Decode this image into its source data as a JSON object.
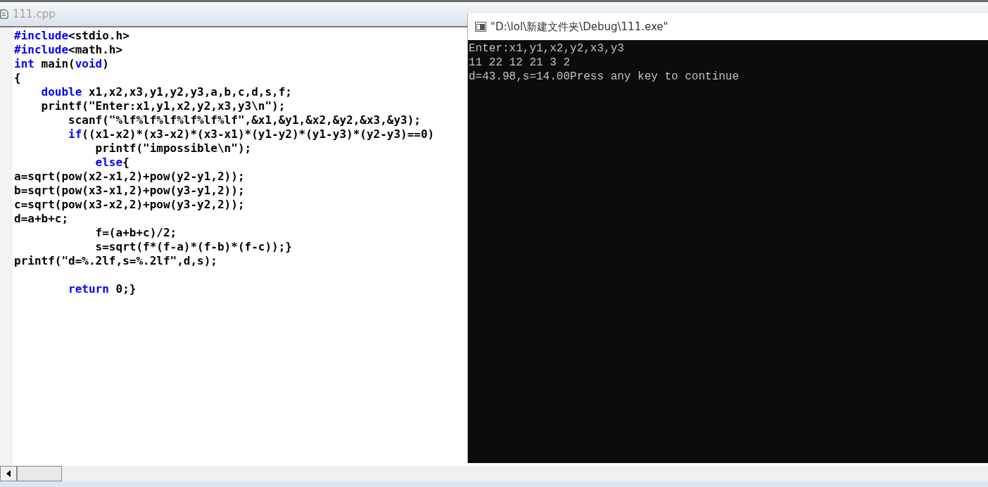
{
  "editor": {
    "tab_title": "111.cpp",
    "lines": [
      {
        "kind": "code",
        "segments": [
          {
            "keyword": true,
            "text": "#include"
          },
          {
            "keyword": false,
            "text": "<stdio.h>"
          }
        ]
      },
      {
        "kind": "code",
        "segments": [
          {
            "keyword": true,
            "text": "#include"
          },
          {
            "keyword": false,
            "text": "<math.h>"
          }
        ]
      },
      {
        "kind": "code",
        "segments": [
          {
            "keyword": true,
            "text": "int"
          },
          {
            "keyword": false,
            "text": " main("
          },
          {
            "keyword": true,
            "text": "void"
          },
          {
            "keyword": false,
            "text": ")"
          }
        ]
      },
      {
        "kind": "code",
        "segments": [
          {
            "keyword": false,
            "text": "{"
          }
        ]
      },
      {
        "kind": "code",
        "segments": [
          {
            "keyword": true,
            "text": "    double"
          },
          {
            "keyword": false,
            "text": " x1,x2,x3,y1,y2,y3,a,b,c,d,s,f;"
          }
        ]
      },
      {
        "kind": "code",
        "segments": [
          {
            "keyword": false,
            "text": "    printf(\"Enter:x1,y1,x2,y2,x3,y3\\n\");"
          }
        ]
      },
      {
        "kind": "code",
        "segments": [
          {
            "keyword": false,
            "text": "        scanf(\"%lf%lf%lf%lf%lf%lf\",&x1,&y1,&x2,&y2,&x3,&y3);"
          }
        ]
      },
      {
        "kind": "code",
        "segments": [
          {
            "keyword": true,
            "text": "        if"
          },
          {
            "keyword": false,
            "text": "((x1-x2)*(x3-x2)*(x3-x1)*(y1-y2)*(y1-y3)*(y2-y3)==0)"
          }
        ]
      },
      {
        "kind": "code",
        "segments": [
          {
            "keyword": false,
            "text": "            printf(\"impossible\\n\");"
          }
        ]
      },
      {
        "kind": "code",
        "segments": [
          {
            "keyword": true,
            "text": "            else"
          },
          {
            "keyword": false,
            "text": "{"
          }
        ]
      },
      {
        "kind": "code",
        "segments": [
          {
            "keyword": false,
            "text": "a=sqrt(pow(x2-x1,2)+pow(y2-y1,2));"
          }
        ]
      },
      {
        "kind": "code",
        "segments": [
          {
            "keyword": false,
            "text": "b=sqrt(pow(x3-x1,2)+pow(y3-y1,2));"
          }
        ]
      },
      {
        "kind": "code",
        "segments": [
          {
            "keyword": false,
            "text": "c=sqrt(pow(x3-x2,2)+pow(y3-y2,2));"
          }
        ]
      },
      {
        "kind": "code",
        "segments": [
          {
            "keyword": false,
            "text": "d=a+b+c;"
          }
        ]
      },
      {
        "kind": "code",
        "segments": [
          {
            "keyword": false,
            "text": "            f=(a+b+c)/2;"
          }
        ]
      },
      {
        "kind": "code",
        "segments": [
          {
            "keyword": false,
            "text": "            s=sqrt(f*(f-a)*(f-b)*(f-c));}"
          }
        ]
      },
      {
        "kind": "code",
        "segments": [
          {
            "keyword": false,
            "text": "printf(\"d=%.2lf,s=%.2lf\",d,s);"
          }
        ]
      },
      {
        "kind": "blank"
      },
      {
        "kind": "code",
        "segments": [
          {
            "keyword": true,
            "text": "        return"
          },
          {
            "keyword": false,
            "text": " 0;}"
          }
        ]
      }
    ]
  },
  "console": {
    "title": "\"D:\\lol\\新建文件夹\\Debug\\111.exe\"",
    "lines": [
      "Enter:x1,y1,x2,y2,x3,y3",
      "11 22 12 21 3 2",
      "d=43.98,s=14.00Press any key to continue"
    ]
  }
}
